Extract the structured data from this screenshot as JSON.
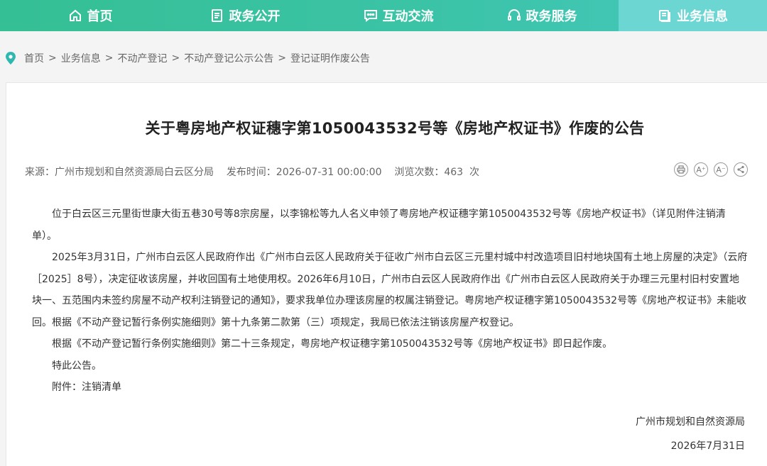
{
  "nav": {
    "items": [
      {
        "label": "首页",
        "icon": "home-icon"
      },
      {
        "label": "政务公开",
        "icon": "document-list-icon"
      },
      {
        "label": "互动交流",
        "icon": "chat-icon"
      },
      {
        "label": "政务服务",
        "icon": "headset-icon"
      },
      {
        "label": "业务信息",
        "icon": "business-book-icon"
      }
    ],
    "active_index": 4,
    "colors": {
      "start": "#35bf94",
      "end": "#44c8bd",
      "active": "#6bd6d2"
    }
  },
  "breadcrumb": {
    "icon": "location-pin-icon",
    "items": [
      "首页",
      "业务信息",
      "不动产登记",
      "不动产登记公示公告",
      "登记证明作废公告"
    ],
    "separator": ">"
  },
  "article": {
    "title": "关于粤房地产权证穗字第1050043532号等《房地产权证书》作废的公告",
    "source": "来源：广州市规划和自然资源局白云区分局",
    "publish_time": "发布时间：2026-07-31 00:00:00",
    "views": "浏览次数：463  次",
    "tools": [
      {
        "name": "print-icon",
        "glyph": ""
      },
      {
        "name": "font-increase-icon",
        "glyph": "A⁺"
      },
      {
        "name": "font-decrease-icon",
        "glyph": "A⁻"
      },
      {
        "name": "share-icon",
        "glyph": ""
      }
    ],
    "paragraphs": [
      "位于白云区三元里街世康大街五巷30号等8宗房屋，以李锦松等九人名义申领了粤房地产权证穗字第1050043532号等《房地产权证书》（详见附件注销清单）。",
      "2025年3月31日，广州市白云区人民政府作出《广州市白云区人民政府关于征收广州市白云区三元里村城中村改造项目旧村地块国有土地上房屋的决定》（云府［2025］8号），决定征收该房屋，并收回国有土地使用权。2026年6月10日，广州市白云区人民政府作出《广州市白云区人民政府关于办理三元里村旧村安置地块一、五范围内未签约房屋不动产权利注销登记的通知》，要求我单位办理该房屋的权属注销登记。粤房地产权证穗字第1050043532号等《房地产权证书》未能收回。根据《不动产登记暂行条例实施细则》第十九条第二款第（三）项规定，我局已依法注销该房屋产权登记。",
      "根据《不动产登记暂行条例实施细则》第二十三条规定，粤房地产权证穗字第1050043532号等《房地产权证书》即日起作废。",
      "特此公告。",
      "附件：注销清单"
    ],
    "signature_org": "广州市规划和自然资源局",
    "signature_date": "2026年7月31日"
  }
}
